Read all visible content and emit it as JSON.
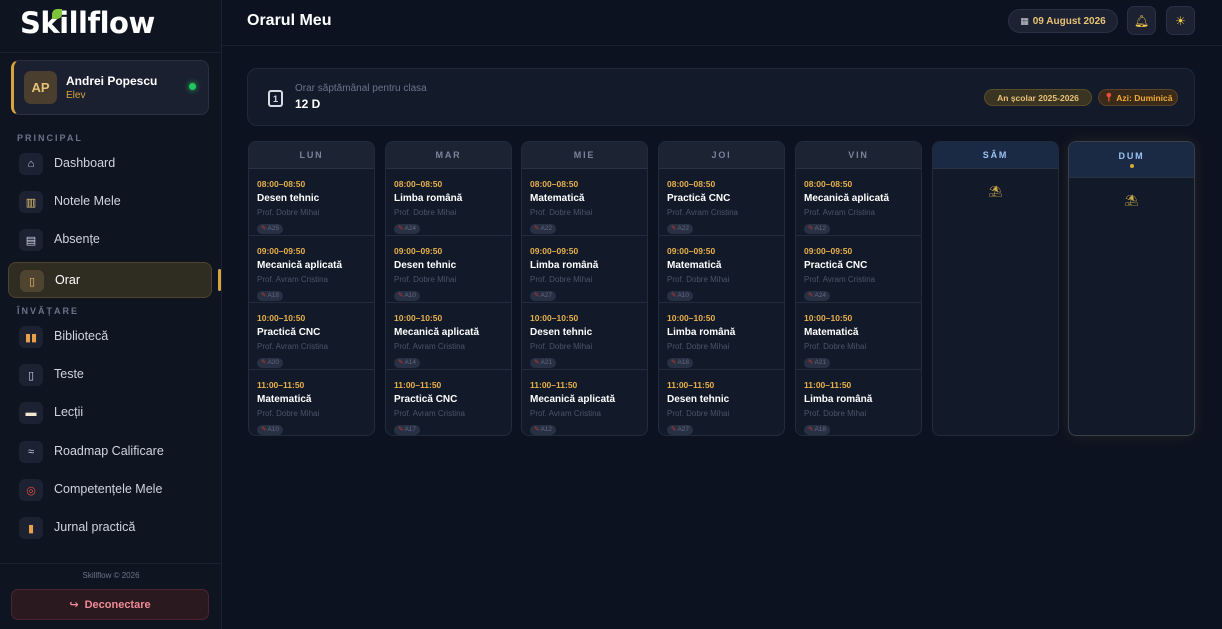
{
  "app": {
    "name": "Skillflow"
  },
  "user": {
    "initials": "AP",
    "name": "Andrei Popescu",
    "role": "Elev"
  },
  "nav": {
    "section_principal": "PRINCIPAL",
    "section_invatare": "ÎNVĂȚARE",
    "items": [
      {
        "label": "Dashboard",
        "icon": "home-icon"
      },
      {
        "label": "Notele Mele",
        "icon": "chart-icon"
      },
      {
        "label": "Absențe",
        "icon": "calendar-list-icon"
      },
      {
        "label": "Orar",
        "icon": "calendar-icon",
        "active": true
      },
      {
        "label": "Bibliotecă",
        "icon": "books-icon"
      },
      {
        "label": "Teste",
        "icon": "clipboard-icon"
      },
      {
        "label": "Lecții",
        "icon": "book-open-icon"
      },
      {
        "label": "Roadmap Calificare",
        "icon": "map-icon"
      },
      {
        "label": "Competențele Mele",
        "icon": "target-icon"
      },
      {
        "label": "Jurnal practică",
        "icon": "journal-icon"
      }
    ]
  },
  "footer": {
    "copyright": "Skillflow © 2026",
    "logout_label": "Deconectare"
  },
  "header": {
    "title": "Orarul Meu",
    "date": "09 August 2026"
  },
  "info": {
    "subtitle": "Orar săptămânal pentru clasa",
    "class_name": "12 D",
    "school_year": "An școlar 2025-2026",
    "today_label": "Azi: Duminică"
  },
  "colors": {
    "accent": "#d9a53a",
    "time": "#e8b04a",
    "weekend_head": "#9cc2f2"
  },
  "days": [
    {
      "label": "LUN",
      "lessons": [
        {
          "time": "08:00–08:50",
          "subject": "Desen tehnic",
          "teacher": "Prof. Dobre Mihai",
          "room": "A25"
        },
        {
          "time": "09:00–09:50",
          "subject": "Mecanică aplicată",
          "teacher": "Prof. Avram Cristina",
          "room": "A18"
        },
        {
          "time": "10:00–10:50",
          "subject": "Practică CNC",
          "teacher": "Prof. Avram Cristina",
          "room": "A20"
        },
        {
          "time": "11:00–11:50",
          "subject": "Matematică",
          "teacher": "Prof. Dobre Mihai",
          "room": "A10"
        }
      ]
    },
    {
      "label": "MAR",
      "lessons": [
        {
          "time": "08:00–08:50",
          "subject": "Limba română",
          "teacher": "Prof. Dobre Mihai",
          "room": "A24"
        },
        {
          "time": "09:00–09:50",
          "subject": "Desen tehnic",
          "teacher": "Prof. Dobre Mihai",
          "room": "A10"
        },
        {
          "time": "10:00–10:50",
          "subject": "Mecanică aplicată",
          "teacher": "Prof. Avram Cristina",
          "room": "A14"
        },
        {
          "time": "11:00–11:50",
          "subject": "Practică CNC",
          "teacher": "Prof. Avram Cristina",
          "room": "A17"
        }
      ]
    },
    {
      "label": "MIE",
      "lessons": [
        {
          "time": "08:00–08:50",
          "subject": "Matematică",
          "teacher": "Prof. Dobre Mihai",
          "room": "A22"
        },
        {
          "time": "09:00–09:50",
          "subject": "Limba română",
          "teacher": "Prof. Dobre Mihai",
          "room": "A27"
        },
        {
          "time": "10:00–10:50",
          "subject": "Desen tehnic",
          "teacher": "Prof. Dobre Mihai",
          "room": "A21"
        },
        {
          "time": "11:00–11:50",
          "subject": "Mecanică aplicată",
          "teacher": "Prof. Avram Cristina",
          "room": "A12"
        }
      ]
    },
    {
      "label": "JOI",
      "lessons": [
        {
          "time": "08:00–08:50",
          "subject": "Practică CNC",
          "teacher": "Prof. Avram Cristina",
          "room": "A22"
        },
        {
          "time": "09:00–09:50",
          "subject": "Matematică",
          "teacher": "Prof. Dobre Mihai",
          "room": "A10"
        },
        {
          "time": "10:00–10:50",
          "subject": "Limba română",
          "teacher": "Prof. Dobre Mihai",
          "room": "A18"
        },
        {
          "time": "11:00–11:50",
          "subject": "Desen tehnic",
          "teacher": "Prof. Dobre Mihai",
          "room": "A27"
        }
      ]
    },
    {
      "label": "VIN",
      "lessons": [
        {
          "time": "08:00–08:50",
          "subject": "Mecanică aplicată",
          "teacher": "Prof. Avram Cristina",
          "room": "A12"
        },
        {
          "time": "09:00–09:50",
          "subject": "Practică CNC",
          "teacher": "Prof. Avram Cristina",
          "room": "A24"
        },
        {
          "time": "10:00–10:50",
          "subject": "Matematică",
          "teacher": "Prof. Dobre Mihai",
          "room": "A21"
        },
        {
          "time": "11:00–11:50",
          "subject": "Limba română",
          "teacher": "Prof. Dobre Mihai",
          "room": "A18"
        }
      ]
    },
    {
      "label": "SÂM",
      "lessons": [],
      "weekend": true,
      "empty_icon": "relax-icon"
    },
    {
      "label": "DUM",
      "lessons": [],
      "weekend": true,
      "today": true,
      "empty_icon": "relax-icon"
    }
  ]
}
